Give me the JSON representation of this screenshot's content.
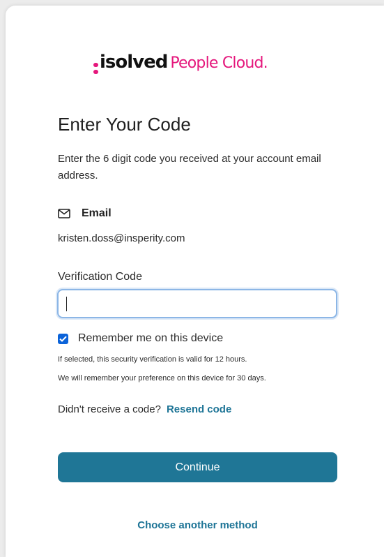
{
  "brand": {
    "logo_name": "isolved",
    "logo_product": "People Cloud.",
    "colors": {
      "accent": "#e5177c",
      "primary": "#1f7696",
      "link": "#1d7496",
      "checkbox": "#0b63d9"
    }
  },
  "page": {
    "title": "Enter Your Code",
    "instructions": "Enter the 6 digit code you received at your account email address."
  },
  "method": {
    "icon": "envelope-icon",
    "label": "Email",
    "value": "kristen.doss@insperity.com"
  },
  "verification": {
    "label": "Verification Code",
    "value": ""
  },
  "remember": {
    "checked": true,
    "label": "Remember me on this device",
    "note_1": "If selected, this security verification is valid for 12 hours.",
    "note_2": "We will remember your preference on this device for 30 days."
  },
  "resend": {
    "prompt": "Didn't receive a code?",
    "link": "Resend code"
  },
  "actions": {
    "continue_label": "Continue",
    "other_method_label": "Choose another method"
  }
}
